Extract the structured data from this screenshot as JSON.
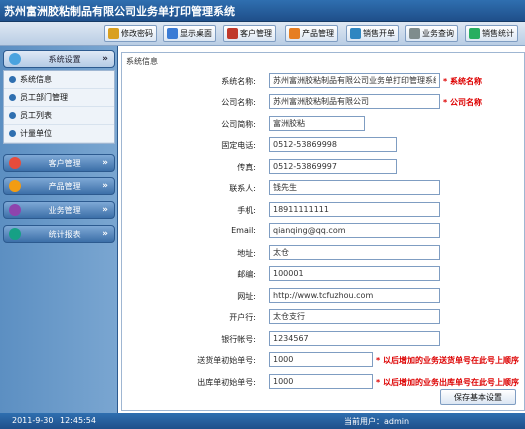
{
  "header": {
    "title": "苏州富洲胶粘制品有限公司业务单打印管理系统"
  },
  "toolbar": [
    {
      "label": "修改密码",
      "icon": "key-icon",
      "color": "#d9a020"
    },
    {
      "label": "显示桌面",
      "icon": "desktop-icon",
      "color": "#3a7bd5"
    },
    {
      "label": "客户管理",
      "icon": "customer-icon",
      "color": "#c0392b"
    },
    {
      "label": "产品管理",
      "icon": "product-icon",
      "color": "#e67e22"
    },
    {
      "label": "销售开单",
      "icon": "sales-order-icon",
      "color": "#2e86c1"
    },
    {
      "label": "业务查询",
      "icon": "query-icon",
      "color": "#7f8c8d"
    },
    {
      "label": "销售统计",
      "icon": "statistics-icon",
      "color": "#27ae60"
    }
  ],
  "sidebar": {
    "sections": [
      {
        "label": "系统设置",
        "icon": "settings-icon",
        "color": "#4aa3df",
        "active": true
      },
      {
        "label": "客户管理",
        "icon": "customer-icon",
        "color": "#e74c3c"
      },
      {
        "label": "产品管理",
        "icon": "product-icon",
        "color": "#f39c12"
      },
      {
        "label": "业务管理",
        "icon": "business-icon",
        "color": "#8e44ad"
      },
      {
        "label": "统计报表",
        "icon": "report-icon",
        "color": "#16a085"
      }
    ],
    "items": [
      {
        "label": "系统信息"
      },
      {
        "label": "员工部门管理"
      },
      {
        "label": "员工列表"
      },
      {
        "label": "计量单位"
      }
    ]
  },
  "panel": {
    "title": "系统信息",
    "save_label": "保存基本设置"
  },
  "form": [
    {
      "label": "系统名称:",
      "value": "苏州富洲胶粘制品有限公司业务单打印管理系统",
      "note": "* 系统名称"
    },
    {
      "label": "公司名称:",
      "value": "苏州富洲胶粘制品有限公司",
      "note": "* 公司名称"
    },
    {
      "label": "公司简称:",
      "value": "富洲胶粘",
      "note": ""
    },
    {
      "label": "固定电话:",
      "value": "0512-53869998",
      "note": ""
    },
    {
      "label": "传真:",
      "value": "0512-53869997",
      "note": ""
    },
    {
      "label": "联系人:",
      "value": "钱先生",
      "note": ""
    },
    {
      "label": "手机:",
      "value": "18911111111",
      "note": ""
    },
    {
      "label": "Email:",
      "value": "qianqing@qq.com",
      "note": ""
    },
    {
      "label": "地址:",
      "value": "太仓",
      "note": ""
    },
    {
      "label": "邮编:",
      "value": "100001",
      "note": ""
    },
    {
      "label": "网址:",
      "value": "http://www.tcfuzhou.com",
      "note": ""
    },
    {
      "label": "开户行:",
      "value": "太仓支行",
      "note": ""
    },
    {
      "label": "银行帐号:",
      "value": "1234567",
      "note": ""
    },
    {
      "label": "送货单初始单号:",
      "value": "1000",
      "note": "* 以后增加的业务送货单号在此号上顺序"
    },
    {
      "label": "出库单初始单号:",
      "value": "1000",
      "note": "* 以后增加的业务出库单号在此号上顺序"
    }
  ],
  "status": {
    "date": "2011-9-30",
    "time": "12:45:54",
    "user_label": "当前用户：admin"
  }
}
